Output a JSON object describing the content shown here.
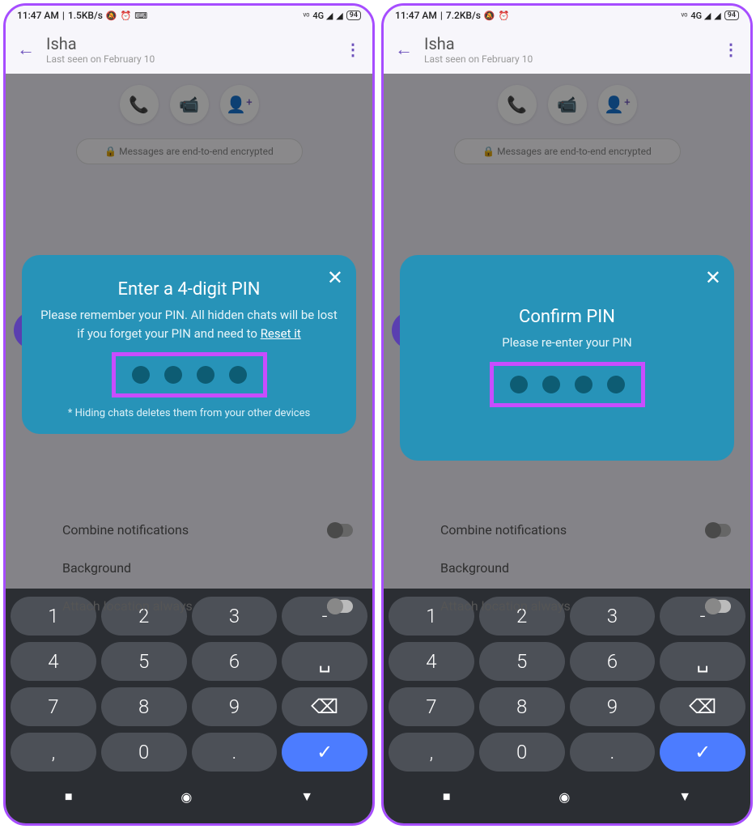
{
  "screens": [
    {
      "status": {
        "time": "11:47 AM",
        "speed": "1.5KB/s",
        "battery": "94"
      },
      "header": {
        "title": "Isha",
        "subtitle": "Last seen on February 10"
      },
      "e2e": "🔒 Messages are end-to-end encrypted",
      "dialog": {
        "title": "Enter a 4-digit PIN",
        "body_pre": "Please remember your PIN. All hidden chats will be lost if you forget your PIN and need to ",
        "body_link": "Reset it",
        "footnote": "* Hiding chats deletes them from your other devices"
      },
      "settings": [
        {
          "label": "Combine notifications",
          "toggle": true
        },
        {
          "label": "Background",
          "toggle": false
        },
        {
          "label": "Attach location always",
          "toggle": true
        }
      ]
    },
    {
      "status": {
        "time": "11:47 AM",
        "speed": "7.2KB/s",
        "battery": "94"
      },
      "header": {
        "title": "Isha",
        "subtitle": "Last seen on February 10"
      },
      "e2e": "🔒 Messages are end-to-end encrypted",
      "dialog": {
        "title": "Confirm PIN",
        "body_pre": "Please re-enter your PIN",
        "body_link": "",
        "footnote": ""
      },
      "settings": [
        {
          "label": "Combine notifications",
          "toggle": true
        },
        {
          "label": "Background",
          "toggle": false
        },
        {
          "label": "Attach location always",
          "toggle": true
        }
      ]
    }
  ],
  "keypad": [
    [
      "1",
      "2",
      "3",
      "-"
    ],
    [
      "4",
      "5",
      "6",
      "␣"
    ],
    [
      "7",
      "8",
      "9",
      "⌫"
    ],
    [
      ",",
      "0",
      ".",
      "✓"
    ]
  ]
}
